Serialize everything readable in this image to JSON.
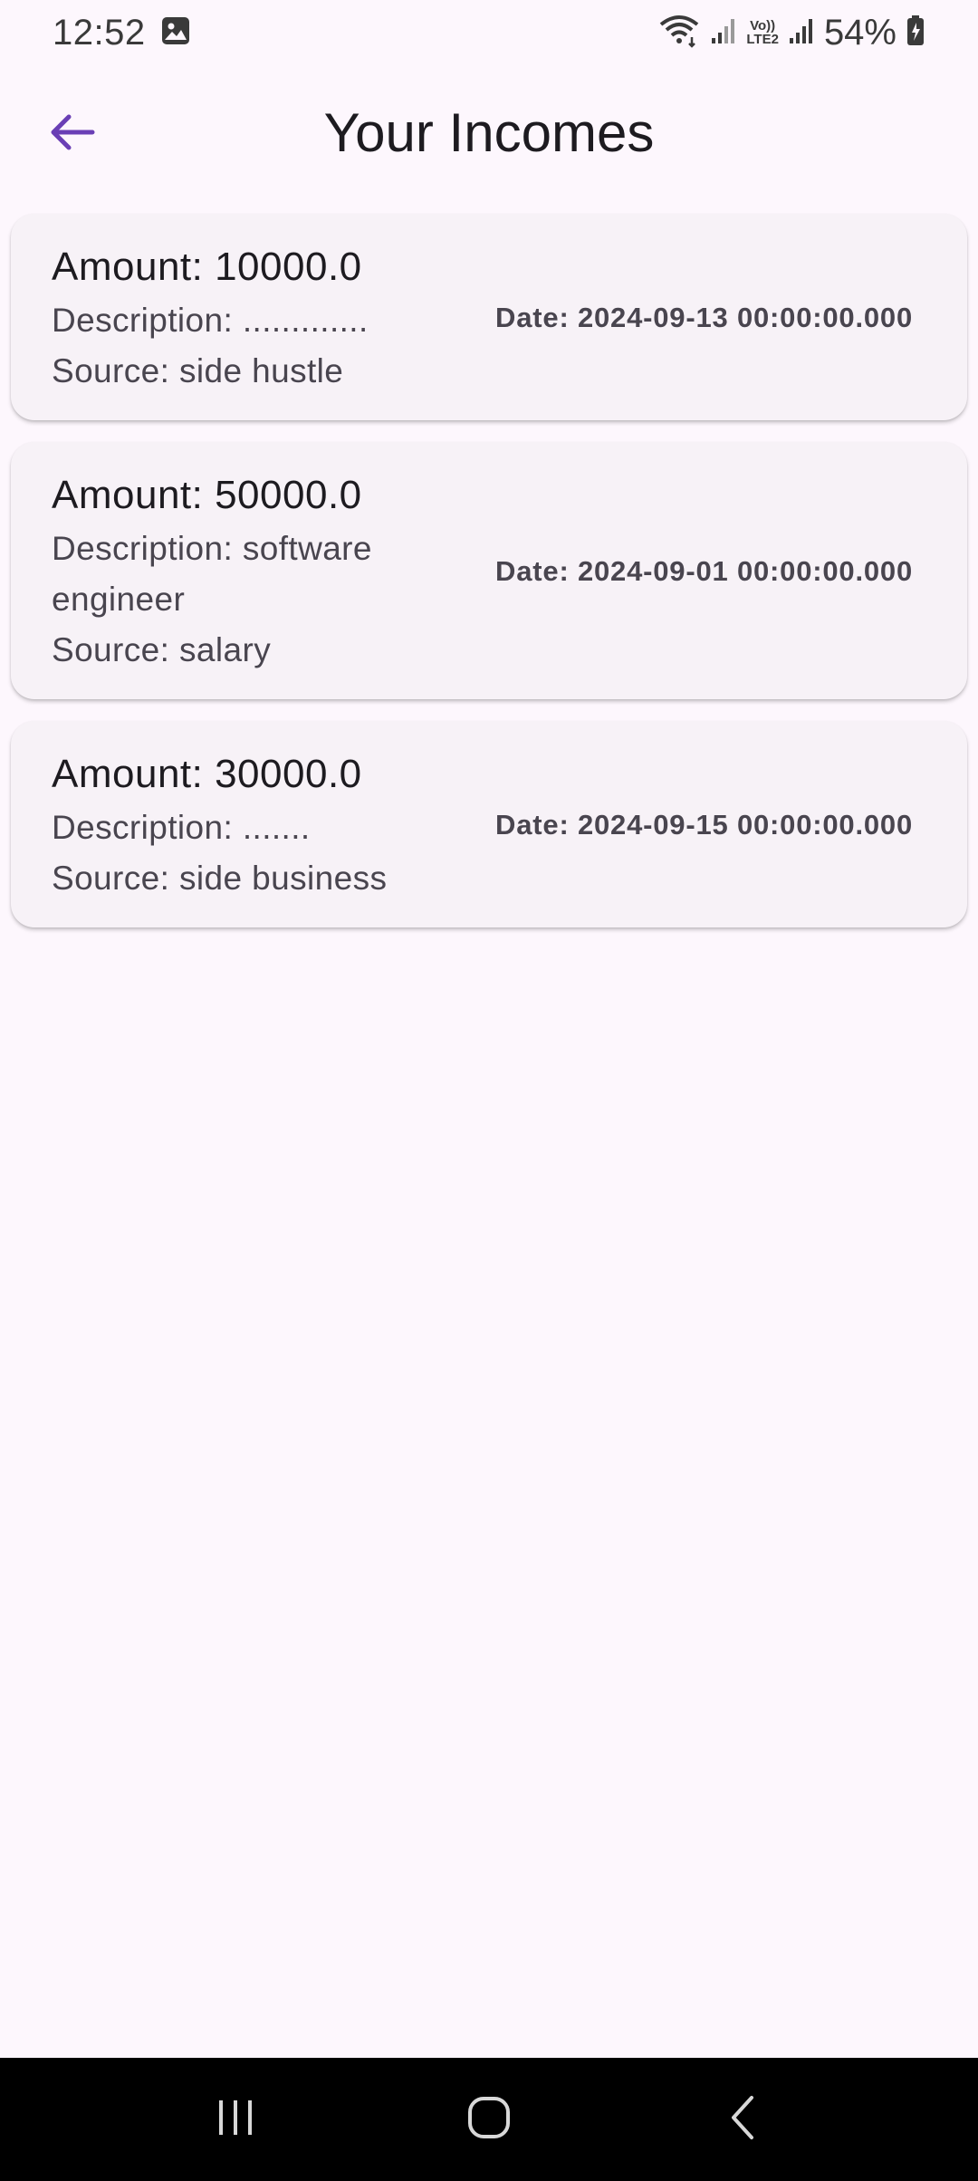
{
  "status_bar": {
    "time": "12:52",
    "battery": "54%",
    "network_label_top": "Vo))",
    "network_label_bottom": "LTE2"
  },
  "app_bar": {
    "title": "Your Incomes",
    "back_icon": "arrow-back-icon",
    "accent_color": "#6a3fb5"
  },
  "incomes": [
    {
      "amount": "Amount: 10000.0",
      "description": "Description: .............",
      "source": "Source: side hustle",
      "date": "Date: 2024-09-13 00:00:00.000"
    },
    {
      "amount": "Amount: 50000.0",
      "description": "Description: software engineer",
      "source": "Source: salary",
      "date": "Date: 2024-09-01 00:00:00.000"
    },
    {
      "amount": "Amount: 30000.0",
      "description": "Description: .......",
      "source": "Source: side business",
      "date": "Date: 2024-09-15 00:00:00.000"
    }
  ],
  "nav_bar": {
    "recents_icon": "recents-icon",
    "home_icon": "home-icon",
    "back_icon": "back-icon"
  }
}
